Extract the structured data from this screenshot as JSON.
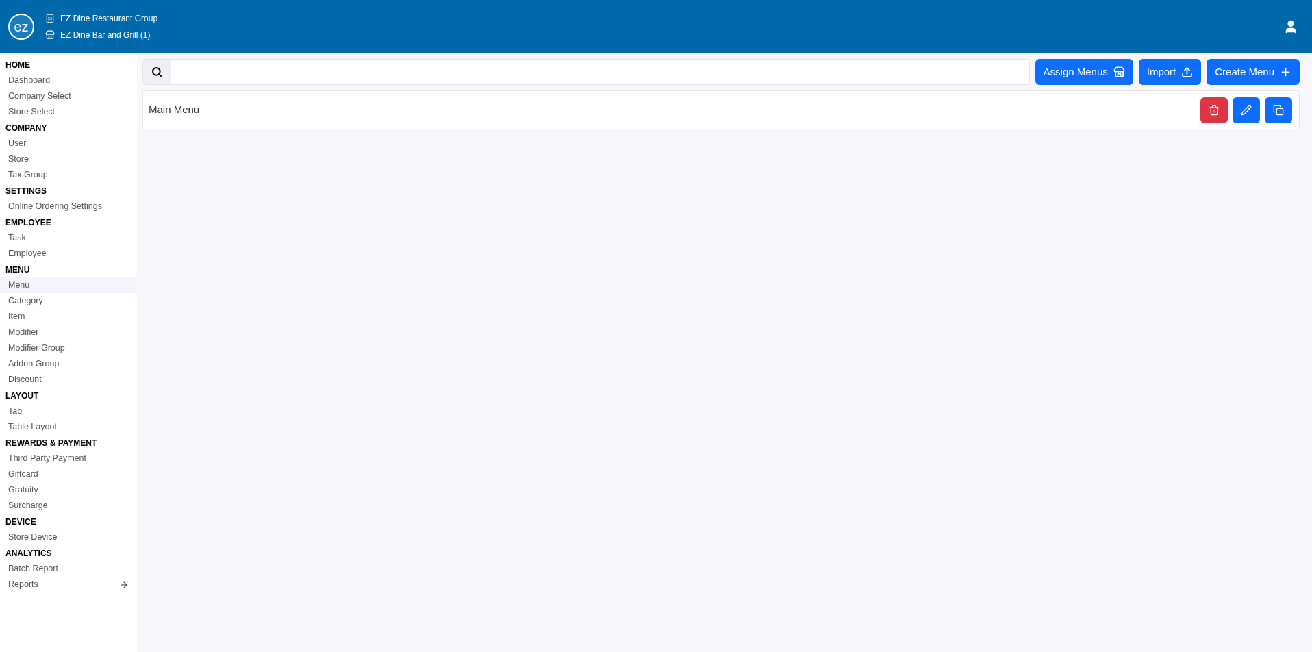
{
  "header": {
    "company": "EZ Dine Restaurant Group",
    "store": "EZ Dine Bar and Grill (1)",
    "logo": "ez"
  },
  "sidebar": {
    "sections": [
      {
        "title": "HOME",
        "items": [
          {
            "label": "Dashboard",
            "selected": false,
            "kind": "link"
          },
          {
            "label": "Company Select",
            "selected": false,
            "kind": "link"
          },
          {
            "label": "Store Select",
            "selected": false,
            "kind": "link"
          }
        ]
      },
      {
        "title": "COMPANY",
        "items": [
          {
            "label": "User",
            "selected": false,
            "kind": "link"
          },
          {
            "label": "Store",
            "selected": false,
            "kind": "link"
          },
          {
            "label": "Tax Group",
            "selected": false,
            "kind": "link"
          }
        ]
      },
      {
        "title": "SETTINGS",
        "items": [
          {
            "label": "Online Ordering Settings",
            "selected": false,
            "kind": "link"
          }
        ]
      },
      {
        "title": "EMPLOYEE",
        "items": [
          {
            "label": "Task",
            "selected": false,
            "kind": "link"
          },
          {
            "label": "Employee",
            "selected": false,
            "kind": "link"
          }
        ]
      },
      {
        "title": "MENU",
        "items": [
          {
            "label": "Menu",
            "selected": true,
            "kind": "link"
          },
          {
            "label": "Category",
            "selected": false,
            "kind": "link"
          },
          {
            "label": "Item",
            "selected": false,
            "kind": "link"
          },
          {
            "label": "Modifier",
            "selected": false,
            "kind": "link"
          },
          {
            "label": "Modifier Group",
            "selected": false,
            "kind": "link"
          },
          {
            "label": "Addon Group",
            "selected": false,
            "kind": "link"
          },
          {
            "label": "Discount",
            "selected": false,
            "kind": "link"
          }
        ]
      },
      {
        "title": "LAYOUT",
        "items": [
          {
            "label": "Tab",
            "selected": false,
            "kind": "link"
          },
          {
            "label": "Table Layout",
            "selected": false,
            "kind": "link"
          }
        ]
      },
      {
        "title": "REWARDS & PAYMENT",
        "items": [
          {
            "label": "Third Party Payment",
            "selected": false,
            "kind": "link"
          },
          {
            "label": "Giftcard",
            "selected": false,
            "kind": "link"
          },
          {
            "label": "Gratuity",
            "selected": false,
            "kind": "link"
          },
          {
            "label": "Surcharge",
            "selected": false,
            "kind": "link"
          }
        ]
      },
      {
        "title": "DEVICE",
        "items": [
          {
            "label": "Store Device",
            "selected": false,
            "kind": "link"
          }
        ]
      },
      {
        "title": "ANALYTICS",
        "items": [
          {
            "label": "Batch Report",
            "selected": false,
            "kind": "link"
          },
          {
            "label": "Reports",
            "selected": false,
            "kind": "external"
          }
        ]
      }
    ]
  },
  "toolbar": {
    "buttons": [
      {
        "label": "Assign Menus",
        "kind": "assign"
      },
      {
        "label": "Import",
        "kind": "import"
      },
      {
        "label": "Create Menu",
        "kind": "create"
      }
    ]
  },
  "menus": [
    {
      "name": "Main Menu"
    }
  ]
}
